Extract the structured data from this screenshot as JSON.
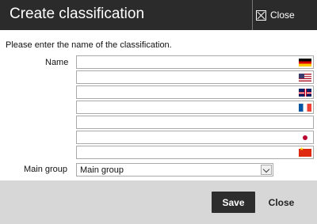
{
  "dialog": {
    "title": "Create classification",
    "close_label": "Close"
  },
  "form": {
    "prompt": "Please enter the name of the classification.",
    "name_label": "Name",
    "name_fields": [
      {
        "lang": "German",
        "flag_icon": "flag-de-icon",
        "value": ""
      },
      {
        "lang": "English (US)",
        "flag_icon": "flag-us-icon",
        "value": ""
      },
      {
        "lang": "English (UK)",
        "flag_icon": "flag-gb-icon",
        "value": ""
      },
      {
        "lang": "French",
        "flag_icon": "flag-fr-icon",
        "value": ""
      },
      {
        "lang": "",
        "flag_icon": "",
        "value": ""
      },
      {
        "lang": "Japanese",
        "flag_icon": "flag-jp-icon",
        "value": ""
      },
      {
        "lang": "Chinese",
        "flag_icon": "flag-cn-icon",
        "value": ""
      }
    ],
    "main_group_label": "Main group",
    "main_group_value": "Main group"
  },
  "footer": {
    "save_label": "Save",
    "close_label": "Close"
  },
  "colors": {
    "titlebar": "#2b2b2b",
    "footer": "#d7d7d7",
    "save_button": "#2d2d2d"
  }
}
